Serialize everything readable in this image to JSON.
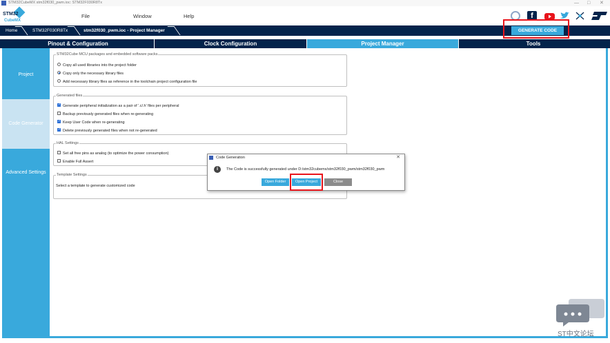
{
  "window": {
    "title": "STM32CubeMX stm32f030_pwm.ioc: STM32F030R8Tx",
    "controls": [
      "—",
      "□",
      "✕"
    ]
  },
  "logo": {
    "line1": "STM32",
    "line2": "CubeMX"
  },
  "menu": [
    "File",
    "Window",
    "Help"
  ],
  "social_icons": [
    "anniversary-icon",
    "facebook-icon",
    "youtube-icon",
    "twitter-icon",
    "network-icon",
    "st-logo-icon"
  ],
  "breadcrumb": {
    "home": "Home",
    "chip": "STM32F030R8Tx",
    "project": "stm32f030_pwm.ioc - Project Manager"
  },
  "generate_button": "GENERATE CODE",
  "tabs": [
    "Pinout & Configuration",
    "Clock Configuration",
    "Project Manager",
    "Tools"
  ],
  "active_tab": "Project Manager",
  "sidebar": [
    "Project",
    "Code Generator",
    "Advanced Settings"
  ],
  "active_sidebar": "Code Generator",
  "groups": {
    "packs": {
      "legend": "STM32Cube MCU packages and embedded software packs",
      "options": [
        {
          "label": "Copy all used libraries into the project folder",
          "checked": false
        },
        {
          "label": "Copy only the necessary library files",
          "checked": true
        },
        {
          "label": "Add necessary library files as reference in the toolchain project configuration file",
          "checked": false
        }
      ]
    },
    "generated": {
      "legend": "Generated files",
      "options": [
        {
          "label": "Generate peripheral initialization as a pair of '.c/.h' files per peripheral",
          "checked": true
        },
        {
          "label": "Backup previously generated files when re-generating",
          "checked": false
        },
        {
          "label": "Keep User Code when re-generating",
          "checked": true
        },
        {
          "label": "Delete previously generated files when not re-generated",
          "checked": true
        }
      ]
    },
    "hal": {
      "legend": "HAL Settings",
      "options": [
        {
          "label": "Set all free pins as analog (to optimize the power consumption)",
          "checked": false
        },
        {
          "label": "Enable Full Assert",
          "checked": false
        }
      ]
    },
    "template": {
      "legend": "Template Settings",
      "text": "Select a template to generate customized code"
    }
  },
  "dialog": {
    "title": "Code Generation",
    "message": "The Code is successfully generated under D:/stm32cubemx/stm32f030_pwm/stm32f030_pwm",
    "buttons": [
      "Open Folder",
      "Open Project",
      "Close"
    ]
  },
  "watermark": "ST中文论坛",
  "colors": {
    "navy": "#03234b",
    "accent": "#39a9dc",
    "highlight": "#e8141b",
    "dialog_button": "#39a9dc",
    "close_button": "#8c8c8c"
  }
}
